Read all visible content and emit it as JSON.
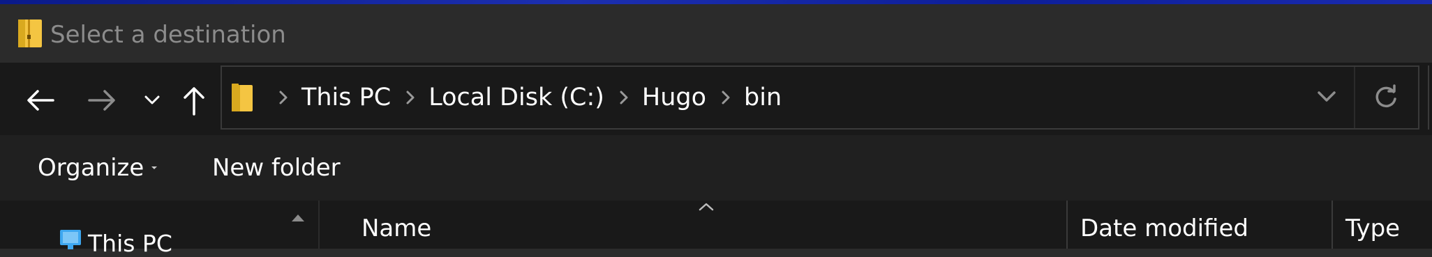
{
  "window": {
    "title": "Select a destination"
  },
  "navigation": {
    "back_icon": "arrow-left-icon",
    "forward_icon": "arrow-right-icon",
    "recent_icon": "chevron-down-icon",
    "up_icon": "arrow-up-icon"
  },
  "address": {
    "crumbs": [
      "This PC",
      "Local Disk (C:)",
      "Hugo",
      "bin"
    ],
    "dropdown_icon": "chevron-down-icon",
    "refresh_icon": "refresh-icon"
  },
  "toolbar": {
    "organize_label": "Organize",
    "new_folder_label": "New folder"
  },
  "nav_pane": {
    "this_pc_label": "This PC"
  },
  "columns": {
    "name": "Name",
    "date_modified": "Date modified",
    "type": "Type"
  },
  "colors": {
    "folder_yellow": "#f4c542",
    "folder_shade": "#d9a91f",
    "title_text": "#8c8c8c",
    "disabled_icon": "#8c8c8c",
    "accent_blue": "#3ea7f0"
  }
}
